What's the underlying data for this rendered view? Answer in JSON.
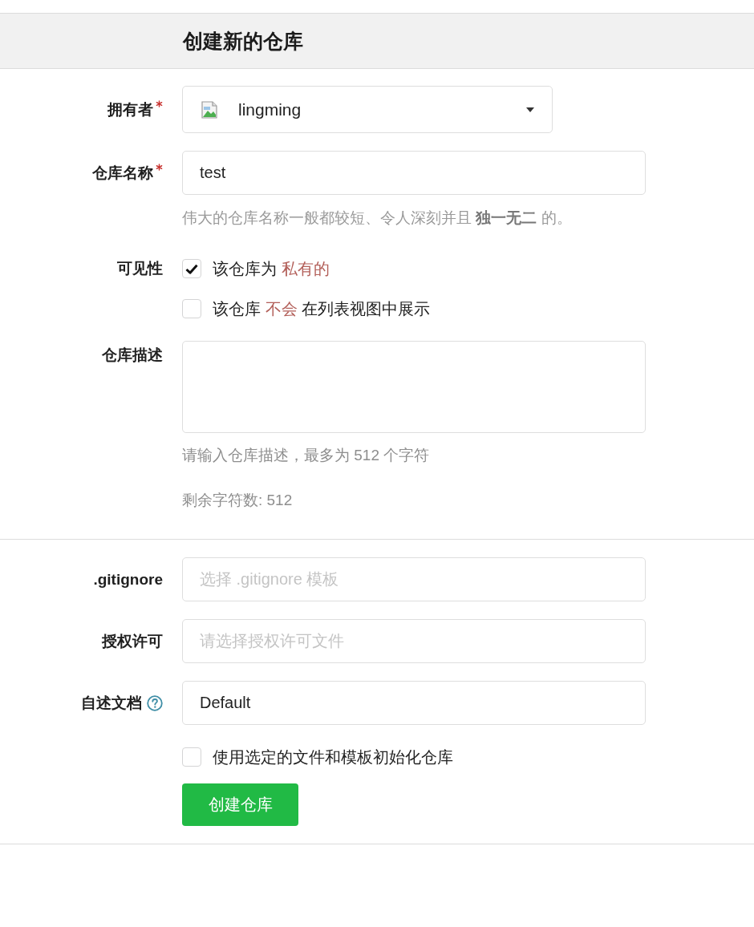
{
  "header": {
    "title": "创建新的仓库"
  },
  "sections": [
    {
      "fields": [
        {
          "kind": "select",
          "label": "拥有者",
          "required": true,
          "help_icon": false,
          "value": "lingming"
        },
        {
          "kind": "text",
          "label": "仓库名称",
          "required": true,
          "help_icon": false,
          "value": "test",
          "help": "伟大的仓库名称一般都较短、令人深刻并且 **独一无二** 的。"
        },
        {
          "kind": "checkboxes",
          "label": "可见性",
          "required": false,
          "help_icon": false,
          "options": [
            {
              "checked": true,
              "parts": [
                {
                  "text": "该仓库为 ",
                  "highlighted": false
                },
                {
                  "text": "私有的",
                  "highlighted": true
                }
              ]
            },
            {
              "checked": false,
              "parts": [
                {
                  "text": "该仓库 ",
                  "highlighted": false
                },
                {
                  "text": "不会",
                  "highlighted": true
                },
                {
                  "text": " 在列表视图中展示",
                  "highlighted": false
                }
              ]
            }
          ]
        },
        {
          "kind": "textarea",
          "label": "仓库描述",
          "required": false,
          "help_icon": false,
          "notes": [
            "请输入仓库描述，最多为 512 个字符",
            "剩余字符数: 512"
          ]
        }
      ]
    },
    {
      "fields": [
        {
          "kind": "text",
          "label": ".gitignore",
          "required": false,
          "help_icon": false,
          "placeholder": "选择 .gitignore 模板"
        },
        {
          "kind": "text",
          "label": "授权许可",
          "required": false,
          "help_icon": false,
          "placeholder": "请选择授权许可文件"
        },
        {
          "kind": "text",
          "label": "自述文档",
          "required": false,
          "help_icon": true,
          "value": "Default"
        },
        {
          "kind": "checkboxes",
          "required": false,
          "help_icon": false,
          "options": [
            {
              "checked": false,
              "parts": [
                {
                  "text": "使用选定的文件和模板初始化仓库",
                  "highlighted": false
                }
              ]
            }
          ]
        }
      ],
      "submit_button": {
        "label": "创建仓库"
      }
    }
  ]
}
